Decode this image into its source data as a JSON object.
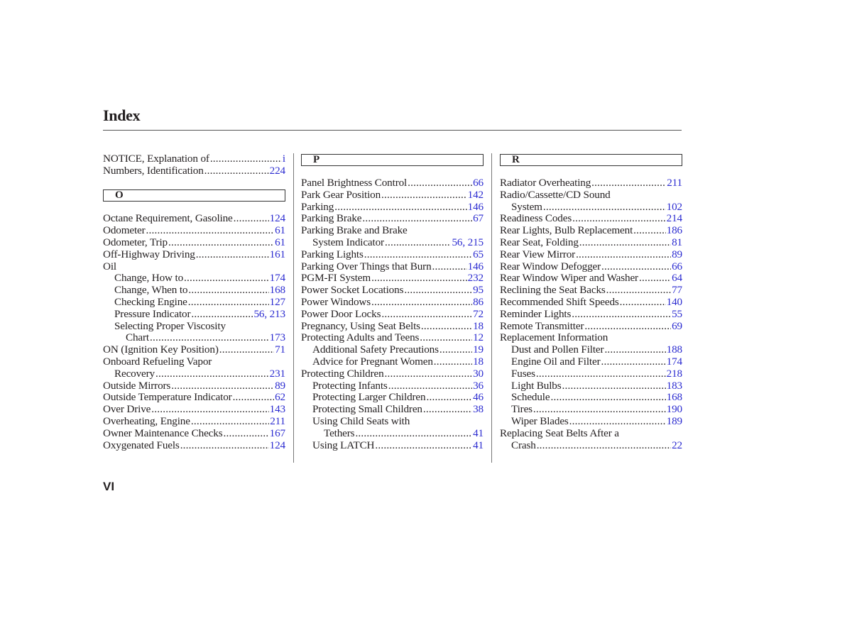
{
  "page": {
    "title": "Index",
    "page_number": "VI",
    "link_color": "#2b2bd0"
  },
  "columns": [
    {
      "blocks": [
        {
          "type": "entries",
          "entries": [
            {
              "text": "NOTICE, Explanation of",
              "page": "i",
              "level": 0
            },
            {
              "text": "Numbers, Identification",
              "page": "224",
              "level": 0
            }
          ]
        },
        {
          "type": "letter",
          "letter": "O"
        },
        {
          "type": "entries",
          "entries": [
            {
              "text": "Octane Requirement, Gasoline",
              "page": "124",
              "level": 0
            },
            {
              "text": "Odometer",
              "page": "61",
              "level": 0
            },
            {
              "text": "Odometer, Trip",
              "page": "61",
              "level": 0
            },
            {
              "text": "Off-Highway Driving",
              "page": "161",
              "level": 0
            },
            {
              "text": "Oil",
              "page": "",
              "level": 0
            },
            {
              "text": "Change, How to",
              "page": "174",
              "level": 1
            },
            {
              "text": "Change, When to",
              "page": "168",
              "level": 1
            },
            {
              "text": "Checking Engine",
              "page": "127",
              "level": 1
            },
            {
              "text": "Pressure Indicator",
              "page": "56, 213",
              "level": 1
            },
            {
              "text": "Selecting Proper Viscosity",
              "page": "",
              "level": 1
            },
            {
              "text": "Chart",
              "page": "173",
              "level": 2
            },
            {
              "text": "ON (Ignition Key Position)",
              "page": "71",
              "level": 0
            },
            {
              "text": "Onboard Refueling Vapor",
              "page": "",
              "level": 0
            },
            {
              "text": "Recovery",
              "page": "231",
              "level": 1
            },
            {
              "text": "Outside Mirrors",
              "page": "89",
              "level": 0
            },
            {
              "text": "Outside Temperature Indicator",
              "page": "62",
              "level": 0
            },
            {
              "text": "Over Drive",
              "page": "143",
              "level": 0
            },
            {
              "text": "Overheating, Engine",
              "page": "211",
              "level": 0
            },
            {
              "text": "Owner Maintenance Checks",
              "page": "167",
              "level": 0
            },
            {
              "text": "Oxygenated Fuels",
              "page": "124",
              "level": 0
            }
          ]
        }
      ]
    },
    {
      "blocks": [
        {
          "type": "letter",
          "letter": "P"
        },
        {
          "type": "entries",
          "entries": [
            {
              "text": "Panel Brightness Control",
              "page": "66",
              "level": 0
            },
            {
              "text": "Park Gear Position",
              "page": "142",
              "level": 0
            },
            {
              "text": "Parking",
              "page": "146",
              "level": 0
            },
            {
              "text": "Parking Brake",
              "page": "67",
              "level": 0
            },
            {
              "text": "Parking Brake and Brake",
              "page": "",
              "level": 0
            },
            {
              "text": "System Indicator",
              "page": "56, 215",
              "level": 1
            },
            {
              "text": "Parking Lights",
              "page": "65",
              "level": 0
            },
            {
              "text": "Parking Over Things that Burn",
              "page": "146",
              "level": 0
            },
            {
              "text": "PGM-FI System",
              "page": "232",
              "level": 0
            },
            {
              "text": "Power Socket Locations",
              "page": "95",
              "level": 0
            },
            {
              "text": "Power Windows",
              "page": "86",
              "level": 0
            },
            {
              "text": "Power Door Locks",
              "page": "72",
              "level": 0
            },
            {
              "text": "Pregnancy, Using Seat Belts",
              "page": "18",
              "level": 0
            },
            {
              "text": "Protecting Adults and Teens",
              "page": "12",
              "level": 0
            },
            {
              "text": "Additional Safety Precautions",
              "page": "19",
              "level": 1
            },
            {
              "text": "Advice for Pregnant Women",
              "page": "18",
              "level": 1
            },
            {
              "text": "Protecting Children",
              "page": "30",
              "level": 0
            },
            {
              "text": "Protecting Infants",
              "page": "36",
              "level": 1
            },
            {
              "text": "Protecting Larger Children",
              "page": "46",
              "level": 1
            },
            {
              "text": "Protecting Small Children",
              "page": "38",
              "level": 1
            },
            {
              "text": "Using Child Seats with",
              "page": "",
              "level": 1
            },
            {
              "text": "Tethers",
              "page": "41",
              "level": 2
            },
            {
              "text": "Using LATCH",
              "page": "41",
              "level": 1
            }
          ]
        }
      ]
    },
    {
      "blocks": [
        {
          "type": "letter",
          "letter": "R"
        },
        {
          "type": "entries",
          "entries": [
            {
              "text": "Radiator Overheating",
              "page": "211",
              "level": 0
            },
            {
              "text": "Radio/Cassette/CD Sound",
              "page": "",
              "level": 0
            },
            {
              "text": "System",
              "page": "102",
              "level": 1
            },
            {
              "text": "Readiness Codes",
              "page": "214",
              "level": 0
            },
            {
              "text": "Rear Lights, Bulb Replacement",
              "page": "186",
              "level": 0
            },
            {
              "text": "Rear Seat, Folding",
              "page": "81",
              "level": 0
            },
            {
              "text": "Rear View Mirror",
              "page": "89",
              "level": 0
            },
            {
              "text": "Rear Window Defogger",
              "page": "66",
              "level": 0
            },
            {
              "text": "Rear Window Wiper and Washer",
              "page": "64",
              "level": 0
            },
            {
              "text": "Reclining the Seat Backs",
              "page": "77",
              "level": 0
            },
            {
              "text": "Recommended Shift Speeds",
              "page": "140",
              "level": 0
            },
            {
              "text": "Reminder Lights",
              "page": "55",
              "level": 0
            },
            {
              "text": "Remote Transmitter",
              "page": "69",
              "level": 0
            },
            {
              "text": "Replacement Information",
              "page": "",
              "level": 0
            },
            {
              "text": "Dust and Pollen Filter",
              "page": "188",
              "level": 1
            },
            {
              "text": "Engine Oil and Filter",
              "page": "174",
              "level": 1
            },
            {
              "text": "Fuses",
              "page": "218",
              "level": 1
            },
            {
              "text": "Light Bulbs",
              "page": "183",
              "level": 1
            },
            {
              "text": "Schedule",
              "page": "168",
              "level": 1
            },
            {
              "text": "Tires",
              "page": "190",
              "level": 1
            },
            {
              "text": "Wiper Blades",
              "page": "189",
              "level": 1
            },
            {
              "text": "Replacing Seat Belts After a",
              "page": "",
              "level": 0
            },
            {
              "text": "Crash",
              "page": "22",
              "level": 1
            }
          ]
        }
      ]
    }
  ]
}
